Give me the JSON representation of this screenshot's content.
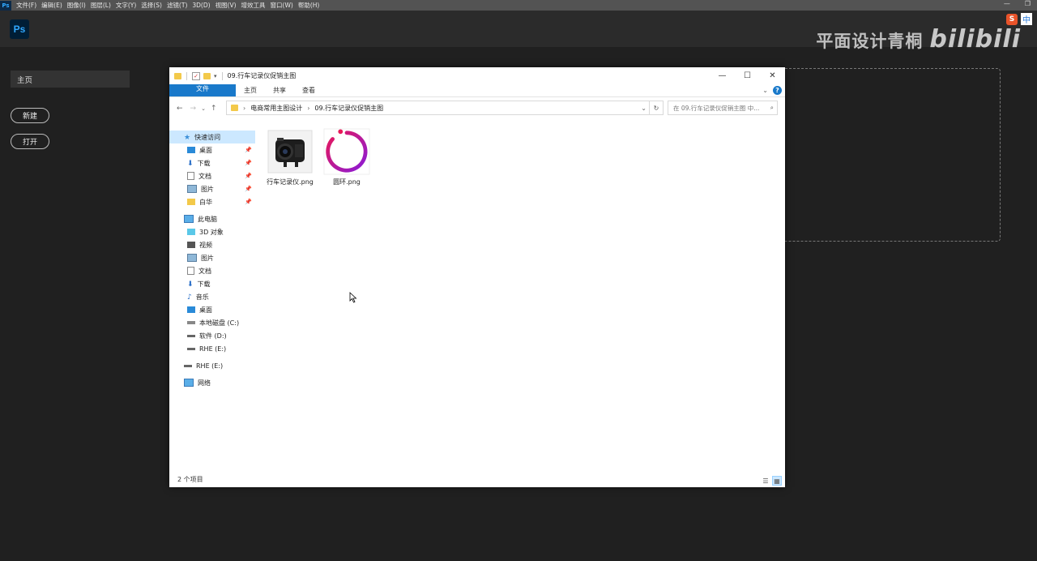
{
  "menubar": {
    "logo": "Ps",
    "items": [
      "文件(F)",
      "编辑(E)",
      "图像(I)",
      "图层(L)",
      "文字(Y)",
      "选择(S)",
      "滤镜(T)",
      "3D(D)",
      "视图(V)",
      "增效工具",
      "窗口(W)",
      "帮助(H)"
    ]
  },
  "app": {
    "ps_label": "Ps",
    "watermark": "平面设计青桐",
    "watermark_brand": "bilibili",
    "ime_zh": "中"
  },
  "home": {
    "tab_label": "主页",
    "new_button": "新建",
    "open_button": "打开"
  },
  "explorer": {
    "title": "09.行车记录仪促销主图",
    "ribbon_tabs": [
      "文件",
      "主页",
      "共享",
      "查看"
    ],
    "breadcrumb": [
      "电商常用主图设计",
      "09.行车记录仪促销主图"
    ],
    "search_placeholder": "在 09.行车记录仪促销主图 中...",
    "nav_quick": [
      {
        "label": "快速访问",
        "icon": "star-icon"
      },
      {
        "label": "桌面",
        "icon": "desktop-icon",
        "pinned": true
      },
      {
        "label": "下载",
        "icon": "download-icon",
        "pinned": true
      },
      {
        "label": "文档",
        "icon": "document-icon",
        "pinned": true
      },
      {
        "label": "图片",
        "icon": "picture-icon",
        "pinned": true
      },
      {
        "label": "白华",
        "icon": "folder-icon",
        "pinned": true
      }
    ],
    "nav_pc": [
      {
        "label": "此电脑",
        "icon": "computer-icon",
        "level": 1
      },
      {
        "label": "3D 对象",
        "icon": "cube-icon",
        "level": 2
      },
      {
        "label": "视频",
        "icon": "video-icon",
        "level": 2
      },
      {
        "label": "图片",
        "icon": "picture-icon",
        "level": 2
      },
      {
        "label": "文档",
        "icon": "document-icon",
        "level": 2
      },
      {
        "label": "下载",
        "icon": "download-icon",
        "level": 2
      },
      {
        "label": "音乐",
        "icon": "music-icon",
        "level": 2
      },
      {
        "label": "桌面",
        "icon": "desktop-icon",
        "level": 2
      },
      {
        "label": "本地磁盘 (C:)",
        "icon": "drive-icon",
        "level": 2
      },
      {
        "label": "软件 (D:)",
        "icon": "drive-icon",
        "level": 2
      },
      {
        "label": "RHE (E:)",
        "icon": "drive-icon",
        "level": 2
      }
    ],
    "nav_extra": [
      {
        "label": "RHE (E:)",
        "icon": "drive-icon"
      },
      {
        "label": "网络",
        "icon": "network-icon"
      }
    ],
    "files": [
      {
        "name": "行车记录仪.png",
        "icon": "dashcam-thumbnail"
      },
      {
        "name": "圆环.png",
        "icon": "ring-thumbnail"
      }
    ],
    "status": "2 个项目"
  }
}
